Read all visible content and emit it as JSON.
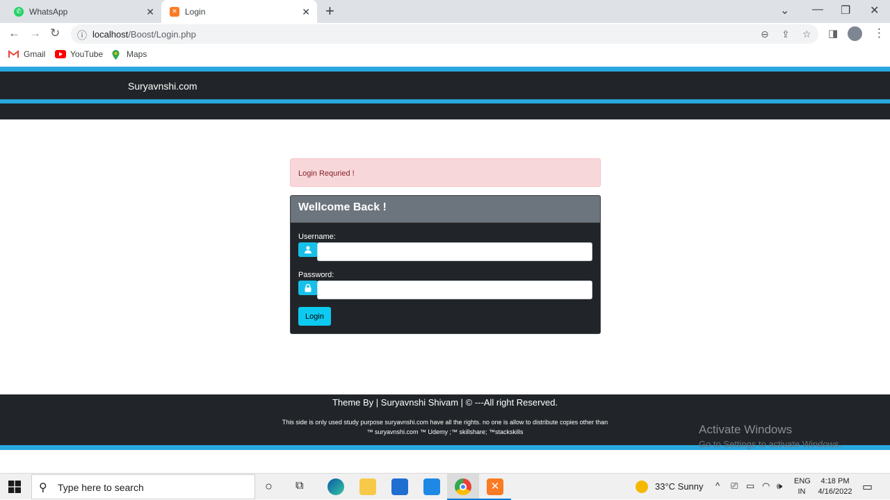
{
  "browser": {
    "tabs": [
      {
        "title": "WhatsApp"
      },
      {
        "title": "Login"
      }
    ],
    "url_host": "localhost",
    "url_path": "/Boost/Login.php",
    "bookmarks": [
      {
        "label": "Gmail"
      },
      {
        "label": "YouTube"
      },
      {
        "label": "Maps"
      }
    ]
  },
  "site": {
    "brand": "Suryavnshi.com"
  },
  "alert": {
    "message": "Login Requried !"
  },
  "login_card": {
    "title": "Wellcome Back !",
    "username_label": "Username:",
    "username_value": "",
    "password_label": "Password:",
    "password_value": "",
    "submit_label": "Login"
  },
  "footer": {
    "credit": "Theme By | Suryavnshi Shivam | © ---All right Reserved.",
    "disclaimer_1": "This side is only used study purpose suryavnshi.com have all the rights. no one is allow to distribute copies other than",
    "disclaimer_2": "™ suryavnshi.com ™ Udemy ;™ skillshare; ™stackskills"
  },
  "watermark": {
    "line1": "Activate Windows",
    "line2": "Go to Settings to activate Windows."
  },
  "taskbar": {
    "search_placeholder": "Type here to search",
    "weather": "33°C  Sunny",
    "lang_1": "ENG",
    "lang_2": "IN",
    "time": "4:18 PM",
    "date": "4/16/2022"
  },
  "colors": {
    "accent_stripe": "#29a8e0",
    "navbar": "#212529",
    "card_header": "#6c757d",
    "button": "#0dcaf0",
    "alert_bg": "#f8d7da"
  }
}
